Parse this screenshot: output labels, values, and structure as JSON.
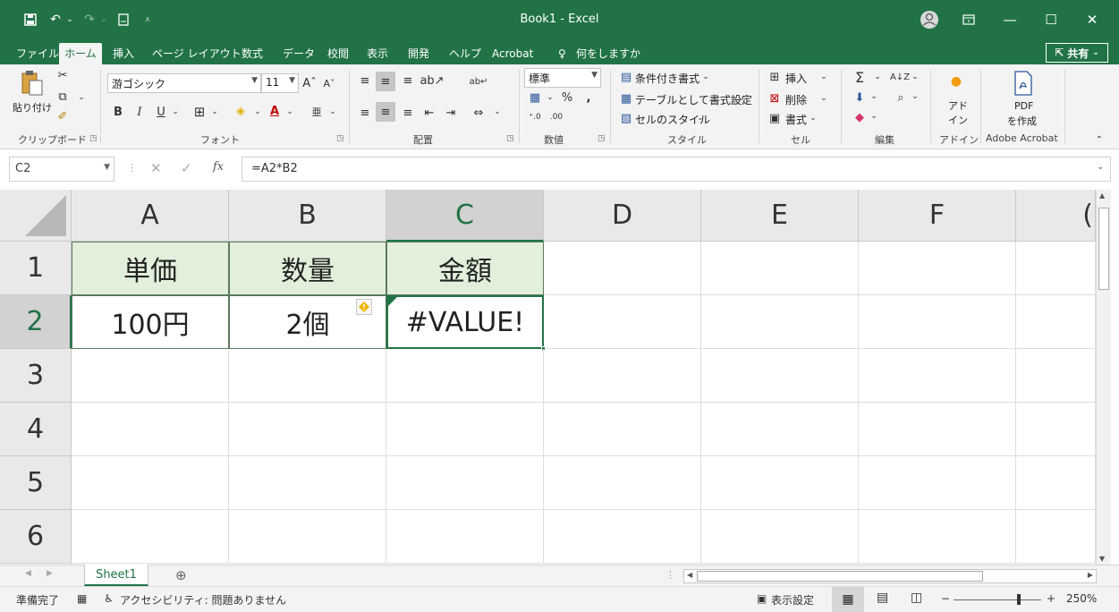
{
  "window": {
    "title": "Book1  -  Excel",
    "qat": [
      "save-icon",
      "undo-icon",
      "redo-icon",
      "new-icon",
      "customize-icon"
    ]
  },
  "tabs": {
    "file": "ファイル",
    "home": "ホーム",
    "insert": "挿入",
    "page_layout": "ページ レイアウト",
    "formulas": "数式",
    "data": "データ",
    "review": "校閲",
    "view": "表示",
    "developer": "開発",
    "help": "ヘルプ",
    "acrobat": "Acrobat",
    "tell_me": "何をしますか",
    "share": "共有"
  },
  "ribbon": {
    "clipboard": {
      "paste": "貼り付け",
      "label": "クリップボード"
    },
    "font": {
      "name": "游ゴシック",
      "size": "11",
      "label": "フォント",
      "bold": "B",
      "italic": "I",
      "underline": "U"
    },
    "alignment": {
      "label": "配置"
    },
    "number": {
      "format": "標準",
      "label": "数値"
    },
    "styles": {
      "conditional": "条件付き書式",
      "as_table": "テーブルとして書式設定",
      "cell_styles": "セルのスタイル",
      "label": "スタイル"
    },
    "cells": {
      "insert": "挿入",
      "delete": "削除",
      "format": "書式",
      "label": "セル"
    },
    "editing": {
      "label": "編集"
    },
    "addins": {
      "button": "アド\nイン",
      "button_line1": "アド",
      "button_line2": "イン",
      "label": "アドイン"
    },
    "acrobat": {
      "pdf": "PDF",
      "create": "を作成",
      "label": "Adobe Acrobat"
    }
  },
  "formula_bar": {
    "name_box": "C2",
    "formula": "=A2*B2",
    "fx": "fx"
  },
  "sheet": {
    "columns": [
      "A",
      "B",
      "C",
      "D",
      "E",
      "F",
      "("
    ],
    "rows": [
      "1",
      "2",
      "3",
      "4",
      "5",
      "6"
    ],
    "cells": {
      "A1": "単価",
      "B1": "数量",
      "C1": "金額",
      "A2": "100円",
      "B2": "2個",
      "C2": "#VALUE!"
    },
    "active_cell": "C2",
    "zoom": "250%"
  },
  "sheet_tabs": {
    "active": "Sheet1"
  },
  "status": {
    "ready": "準備完了",
    "accessibility": "アクセシビリティ: 問題ありません",
    "display_settings": "表示設定",
    "zoom": "250%"
  },
  "colors": {
    "accent": "#217346",
    "header_fill": "#e2efda",
    "selected_header": "#d2d2d2"
  }
}
